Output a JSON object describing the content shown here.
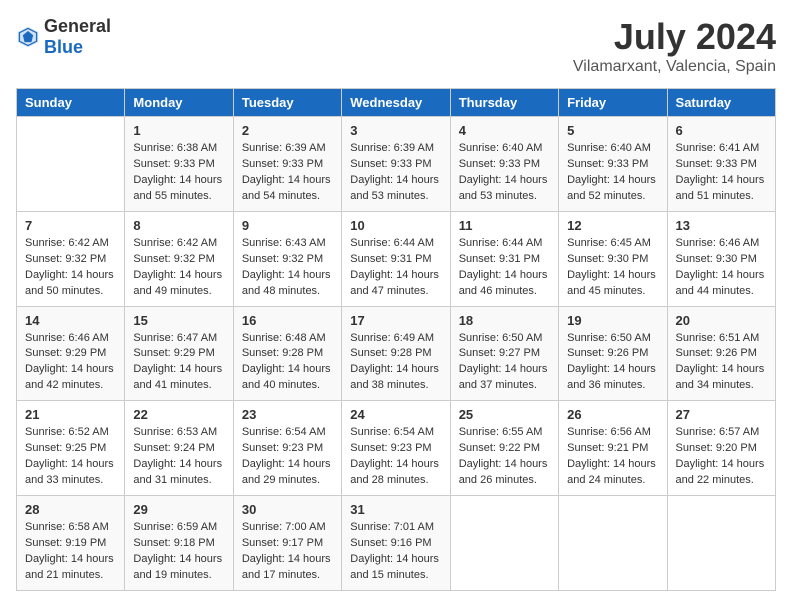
{
  "header": {
    "logo_general": "General",
    "logo_blue": "Blue",
    "title": "July 2024",
    "location": "Vilamarxant, Valencia, Spain"
  },
  "weekdays": [
    "Sunday",
    "Monday",
    "Tuesday",
    "Wednesday",
    "Thursday",
    "Friday",
    "Saturday"
  ],
  "weeks": [
    [
      {
        "day": "",
        "sunrise": "",
        "sunset": "",
        "daylight": ""
      },
      {
        "day": "1",
        "sunrise": "Sunrise: 6:38 AM",
        "sunset": "Sunset: 9:33 PM",
        "daylight": "Daylight: 14 hours and 55 minutes."
      },
      {
        "day": "2",
        "sunrise": "Sunrise: 6:39 AM",
        "sunset": "Sunset: 9:33 PM",
        "daylight": "Daylight: 14 hours and 54 minutes."
      },
      {
        "day": "3",
        "sunrise": "Sunrise: 6:39 AM",
        "sunset": "Sunset: 9:33 PM",
        "daylight": "Daylight: 14 hours and 53 minutes."
      },
      {
        "day": "4",
        "sunrise": "Sunrise: 6:40 AM",
        "sunset": "Sunset: 9:33 PM",
        "daylight": "Daylight: 14 hours and 53 minutes."
      },
      {
        "day": "5",
        "sunrise": "Sunrise: 6:40 AM",
        "sunset": "Sunset: 9:33 PM",
        "daylight": "Daylight: 14 hours and 52 minutes."
      },
      {
        "day": "6",
        "sunrise": "Sunrise: 6:41 AM",
        "sunset": "Sunset: 9:33 PM",
        "daylight": "Daylight: 14 hours and 51 minutes."
      }
    ],
    [
      {
        "day": "7",
        "sunrise": "Sunrise: 6:42 AM",
        "sunset": "Sunset: 9:32 PM",
        "daylight": "Daylight: 14 hours and 50 minutes."
      },
      {
        "day": "8",
        "sunrise": "Sunrise: 6:42 AM",
        "sunset": "Sunset: 9:32 PM",
        "daylight": "Daylight: 14 hours and 49 minutes."
      },
      {
        "day": "9",
        "sunrise": "Sunrise: 6:43 AM",
        "sunset": "Sunset: 9:32 PM",
        "daylight": "Daylight: 14 hours and 48 minutes."
      },
      {
        "day": "10",
        "sunrise": "Sunrise: 6:44 AM",
        "sunset": "Sunset: 9:31 PM",
        "daylight": "Daylight: 14 hours and 47 minutes."
      },
      {
        "day": "11",
        "sunrise": "Sunrise: 6:44 AM",
        "sunset": "Sunset: 9:31 PM",
        "daylight": "Daylight: 14 hours and 46 minutes."
      },
      {
        "day": "12",
        "sunrise": "Sunrise: 6:45 AM",
        "sunset": "Sunset: 9:30 PM",
        "daylight": "Daylight: 14 hours and 45 minutes."
      },
      {
        "day": "13",
        "sunrise": "Sunrise: 6:46 AM",
        "sunset": "Sunset: 9:30 PM",
        "daylight": "Daylight: 14 hours and 44 minutes."
      }
    ],
    [
      {
        "day": "14",
        "sunrise": "Sunrise: 6:46 AM",
        "sunset": "Sunset: 9:29 PM",
        "daylight": "Daylight: 14 hours and 42 minutes."
      },
      {
        "day": "15",
        "sunrise": "Sunrise: 6:47 AM",
        "sunset": "Sunset: 9:29 PM",
        "daylight": "Daylight: 14 hours and 41 minutes."
      },
      {
        "day": "16",
        "sunrise": "Sunrise: 6:48 AM",
        "sunset": "Sunset: 9:28 PM",
        "daylight": "Daylight: 14 hours and 40 minutes."
      },
      {
        "day": "17",
        "sunrise": "Sunrise: 6:49 AM",
        "sunset": "Sunset: 9:28 PM",
        "daylight": "Daylight: 14 hours and 38 minutes."
      },
      {
        "day": "18",
        "sunrise": "Sunrise: 6:50 AM",
        "sunset": "Sunset: 9:27 PM",
        "daylight": "Daylight: 14 hours and 37 minutes."
      },
      {
        "day": "19",
        "sunrise": "Sunrise: 6:50 AM",
        "sunset": "Sunset: 9:26 PM",
        "daylight": "Daylight: 14 hours and 36 minutes."
      },
      {
        "day": "20",
        "sunrise": "Sunrise: 6:51 AM",
        "sunset": "Sunset: 9:26 PM",
        "daylight": "Daylight: 14 hours and 34 minutes."
      }
    ],
    [
      {
        "day": "21",
        "sunrise": "Sunrise: 6:52 AM",
        "sunset": "Sunset: 9:25 PM",
        "daylight": "Daylight: 14 hours and 33 minutes."
      },
      {
        "day": "22",
        "sunrise": "Sunrise: 6:53 AM",
        "sunset": "Sunset: 9:24 PM",
        "daylight": "Daylight: 14 hours and 31 minutes."
      },
      {
        "day": "23",
        "sunrise": "Sunrise: 6:54 AM",
        "sunset": "Sunset: 9:23 PM",
        "daylight": "Daylight: 14 hours and 29 minutes."
      },
      {
        "day": "24",
        "sunrise": "Sunrise: 6:54 AM",
        "sunset": "Sunset: 9:23 PM",
        "daylight": "Daylight: 14 hours and 28 minutes."
      },
      {
        "day": "25",
        "sunrise": "Sunrise: 6:55 AM",
        "sunset": "Sunset: 9:22 PM",
        "daylight": "Daylight: 14 hours and 26 minutes."
      },
      {
        "day": "26",
        "sunrise": "Sunrise: 6:56 AM",
        "sunset": "Sunset: 9:21 PM",
        "daylight": "Daylight: 14 hours and 24 minutes."
      },
      {
        "day": "27",
        "sunrise": "Sunrise: 6:57 AM",
        "sunset": "Sunset: 9:20 PM",
        "daylight": "Daylight: 14 hours and 22 minutes."
      }
    ],
    [
      {
        "day": "28",
        "sunrise": "Sunrise: 6:58 AM",
        "sunset": "Sunset: 9:19 PM",
        "daylight": "Daylight: 14 hours and 21 minutes."
      },
      {
        "day": "29",
        "sunrise": "Sunrise: 6:59 AM",
        "sunset": "Sunset: 9:18 PM",
        "daylight": "Daylight: 14 hours and 19 minutes."
      },
      {
        "day": "30",
        "sunrise": "Sunrise: 7:00 AM",
        "sunset": "Sunset: 9:17 PM",
        "daylight": "Daylight: 14 hours and 17 minutes."
      },
      {
        "day": "31",
        "sunrise": "Sunrise: 7:01 AM",
        "sunset": "Sunset: 9:16 PM",
        "daylight": "Daylight: 14 hours and 15 minutes."
      },
      {
        "day": "",
        "sunrise": "",
        "sunset": "",
        "daylight": ""
      },
      {
        "day": "",
        "sunrise": "",
        "sunset": "",
        "daylight": ""
      },
      {
        "day": "",
        "sunrise": "",
        "sunset": "",
        "daylight": ""
      }
    ]
  ]
}
